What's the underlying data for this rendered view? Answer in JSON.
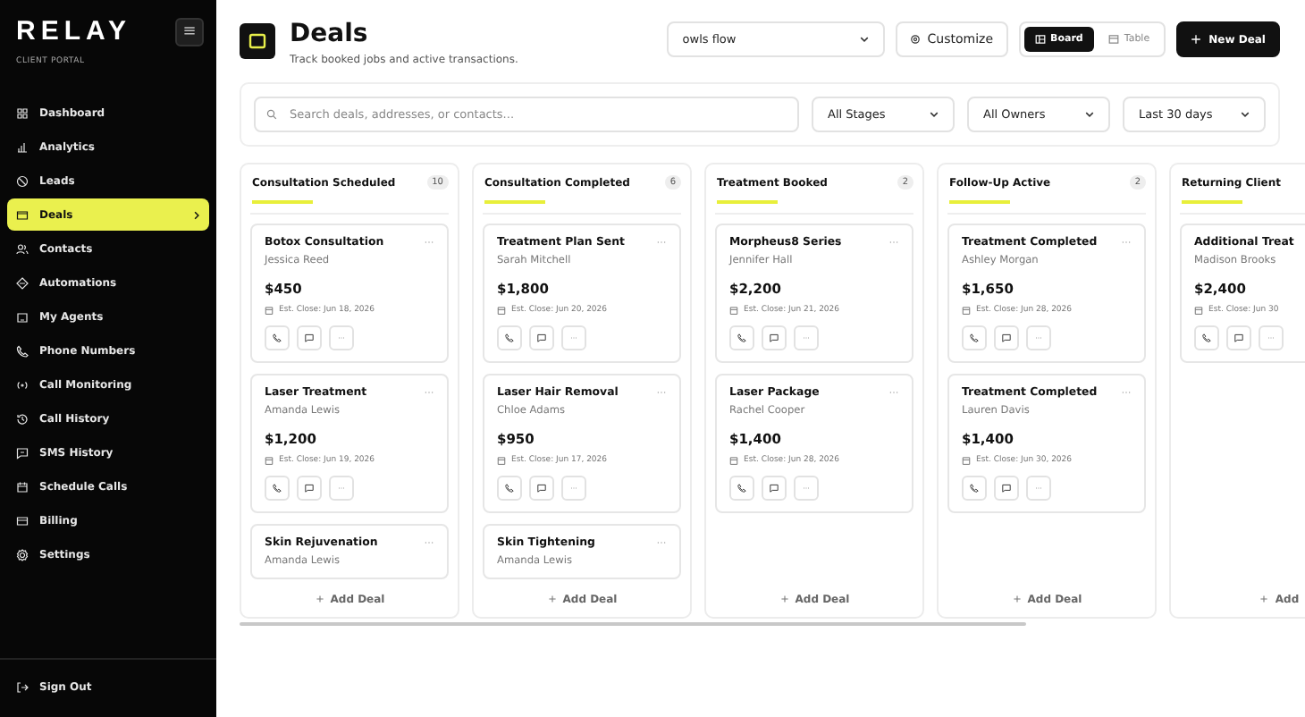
{
  "sidebar": {
    "logo": "RELAY",
    "subtitle": "CLIENT PORTAL",
    "menu_button": "≡",
    "items": [
      {
        "label": "Dashboard",
        "selected": false
      },
      {
        "label": "Analytics",
        "selected": false
      },
      {
        "label": "Leads",
        "selected": false
      },
      {
        "label": "Deals",
        "selected": true
      },
      {
        "label": "Contacts",
        "selected": false
      },
      {
        "label": "Automations",
        "selected": false
      },
      {
        "label": "My Agents",
        "selected": false
      },
      {
        "label": "Phone Numbers",
        "selected": false
      },
      {
        "label": "Call Monitoring",
        "selected": false
      },
      {
        "label": "Call History",
        "selected": false
      },
      {
        "label": "SMS History",
        "selected": false
      },
      {
        "label": "Schedule Calls",
        "selected": false
      },
      {
        "label": "Billing",
        "selected": false
      },
      {
        "label": "Settings",
        "selected": false
      }
    ],
    "sign_out": "Sign Out"
  },
  "header": {
    "title": "Deals",
    "subtitle": "Track booked jobs and active transactions.",
    "pipeline": "owls flow",
    "customize": "Customize",
    "views": [
      {
        "label": "Board",
        "selected": true
      },
      {
        "label": "Table",
        "selected": false
      }
    ],
    "new_deal": "New Deal"
  },
  "filters": {
    "search_placeholder": "Search deals, addresses, or contacts...",
    "selects": [
      "All Stages",
      "All Owners",
      "Last 30 days"
    ]
  },
  "columns": [
    {
      "title": "Consultation Scheduled",
      "count": "10",
      "add_label": "Add Deal",
      "cards": [
        {
          "title": "Botox Consultation",
          "contact": "Jessica Reed",
          "amount": "$450",
          "close": "Est. Close: Jun 18, 2026"
        },
        {
          "title": "Laser Treatment",
          "contact": "Amanda Lewis",
          "amount": "$1,200",
          "close": "Est. Close: Jun 19, 2026"
        },
        {
          "title": "Skin Rejuvenation",
          "contact": "Amanda Lewis"
        }
      ]
    },
    {
      "title": "Consultation Completed",
      "count": "6",
      "add_label": "Add Deal",
      "cards": [
        {
          "title": "Treatment Plan Sent",
          "contact": "Sarah Mitchell",
          "amount": "$1,800",
          "close": "Est. Close: Jun 20, 2026"
        },
        {
          "title": "Laser Hair Removal",
          "contact": "Chloe Adams",
          "amount": "$950",
          "close": "Est. Close: Jun 17, 2026"
        },
        {
          "title": "Skin Tightening",
          "contact": "Amanda Lewis"
        }
      ]
    },
    {
      "title": "Treatment Booked",
      "count": "2",
      "add_label": "Add Deal",
      "cards": [
        {
          "title": "Morpheus8 Series",
          "contact": "Jennifer Hall",
          "amount": "$2,200",
          "close": "Est. Close: Jun 21, 2026"
        },
        {
          "title": "Laser Package",
          "contact": "Rachel Cooper",
          "amount": "$1,400",
          "close": "Est. Close: Jun 28, 2026"
        }
      ]
    },
    {
      "title": "Follow-Up Active",
      "count": "2",
      "add_label": "Add Deal",
      "cards": [
        {
          "title": "Treatment Completed",
          "contact": "Ashley Morgan",
          "amount": "$1,650",
          "close": "Est. Close: Jun 28, 2026"
        },
        {
          "title": "Treatment Completed",
          "contact": "Lauren Davis",
          "amount": "$1,400",
          "close": "Est. Close: Jun 30, 2026"
        }
      ]
    },
    {
      "title": "Returning Client",
      "add_label": "Add",
      "cards": [
        {
          "title": "Additional Treat",
          "contact": "Madison Brooks",
          "amount": "$2,400",
          "close": "Est. Close: Jun 30"
        }
      ]
    }
  ]
}
